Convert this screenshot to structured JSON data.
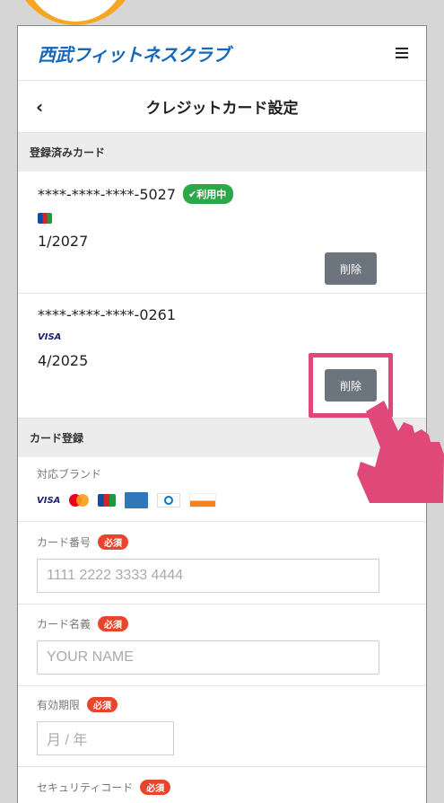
{
  "header": {
    "logo": "西武フィットネスクラブ",
    "menu_icon": "hamburger-icon"
  },
  "titlebar": {
    "back": "‹",
    "title": "クレジットカード設定"
  },
  "registered": {
    "heading": "登録済みカード",
    "cards": [
      {
        "number": "****-****-****-5027",
        "brand": "JCB",
        "status": "✔利用中",
        "expiry": "1/2027",
        "delete_label": "削除"
      },
      {
        "number": "****-****-****-0261",
        "brand": "VISA",
        "expiry": "4/2025",
        "delete_label": "削除"
      }
    ]
  },
  "register": {
    "heading": "カード登録",
    "brands_label": "対応ブランド",
    "brands": [
      "VISA",
      "Mastercard",
      "JCB",
      "AMEX",
      "Diners Club",
      "DISCOVER"
    ],
    "card_number": {
      "label": "カード番号",
      "required": "必須",
      "placeholder": "1111 2222 3333 4444"
    },
    "card_name": {
      "label": "カード名義",
      "required": "必須",
      "placeholder": "YOUR NAME"
    },
    "expiry": {
      "label": "有効期限",
      "required": "必須",
      "placeholder": "月 / 年"
    },
    "security": {
      "label": "セキュリティコード",
      "required": "必須"
    }
  },
  "colors": {
    "accent": "#1668b8",
    "highlight": "#e0487a",
    "in_use": "#2ba84a",
    "required": "#e8452c",
    "step": "#f5a623"
  }
}
